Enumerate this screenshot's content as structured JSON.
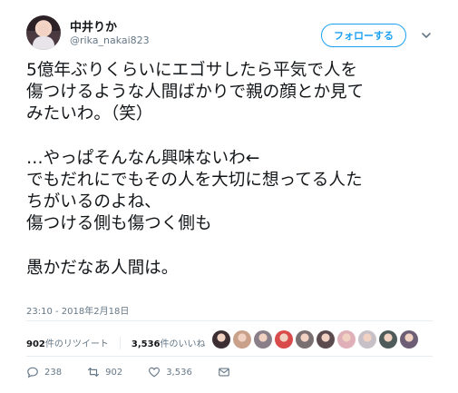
{
  "user": {
    "display_name": "中井りか",
    "handle": "@rika_nakai823"
  },
  "follow_button": {
    "label": "フォローする"
  },
  "tweet": {
    "lines": [
      "5億年ぶりくらいにエゴサしたら平気で人を",
      "傷つけるような人間ばかりで親の顔とか見て",
      "みたいわ。（笑）",
      "",
      "…やっぱそんなん興味ないわ←",
      "でもだれにでもその人を大切に想ってる人た",
      "ちがいるのよね、",
      "傷つける側も傷つく側も",
      "",
      "愚かだなあ人間は。"
    ]
  },
  "timestamp": "23:10 - 2018年2月18日",
  "stats": {
    "retweets_count": "902",
    "retweets_label": "件のリツイート",
    "likes_count": "3,536",
    "likes_label": "件のいいね"
  },
  "liker_avatars": [
    "#3b2f33",
    "#c9a18a",
    "#8a7f88",
    "#d94b4b",
    "#7a6f70",
    "#5b4a4e",
    "#e0b0b8",
    "#c7c1c7",
    "#4f5b5a",
    "#6d5e76"
  ],
  "actions": {
    "reply_count": "238",
    "retweet_count": "902",
    "like_count": "3,536"
  },
  "colors": {
    "accent": "#1da1f2",
    "secondary_text": "#657786",
    "divider": "#e6ecf0"
  }
}
